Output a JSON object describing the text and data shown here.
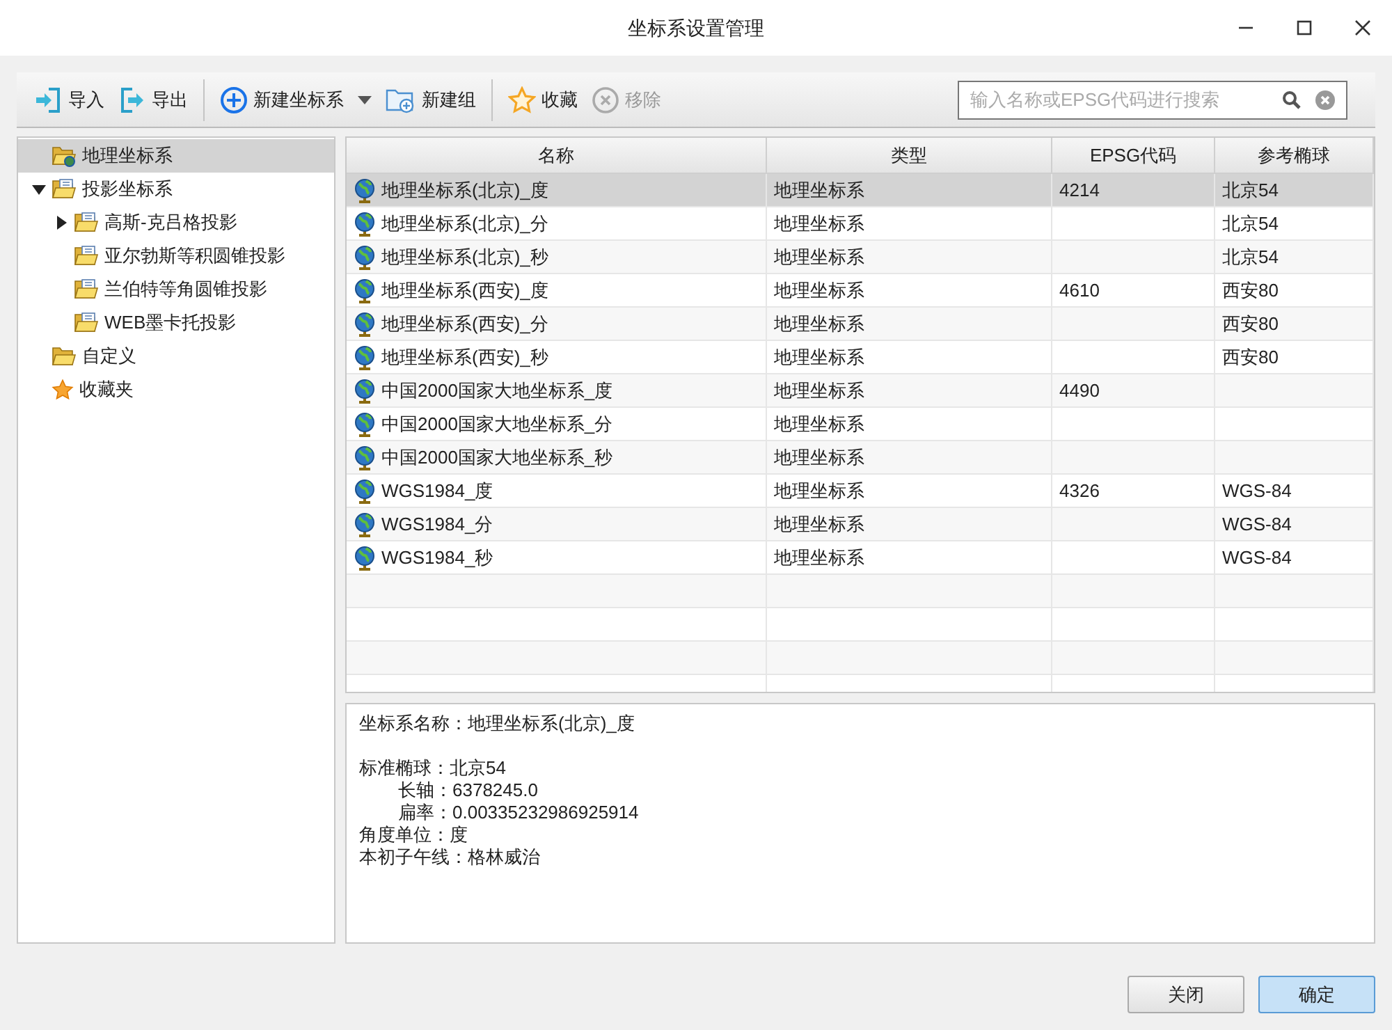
{
  "window": {
    "title": "坐标系设置管理"
  },
  "toolbar": {
    "groups": [
      [
        {
          "kind": "import",
          "label": "导入",
          "disabled": false
        },
        {
          "kind": "export",
          "label": "导出",
          "disabled": false
        }
      ],
      [
        {
          "kind": "add",
          "label": "新建坐标系",
          "disabled": false,
          "dropdown": true
        },
        {
          "kind": "new-group",
          "label": "新建组",
          "disabled": false
        }
      ],
      [
        {
          "kind": "favorite",
          "label": "收藏",
          "disabled": false
        },
        {
          "kind": "remove",
          "label": "移除",
          "disabled": true
        }
      ]
    ],
    "search": {
      "placeholder": "输入名称或EPSG代码进行搜索"
    }
  },
  "tree": [
    {
      "kind": "geo-folder",
      "label": "地理坐标系",
      "selected": true
    },
    {
      "kind": "proj-folder",
      "label": "投影坐标系",
      "selected": false,
      "expanded": true,
      "children": [
        {
          "kind": "proj-folder",
          "label": "高斯-克吕格投影",
          "selected": false,
          "expanded": false
        },
        {
          "kind": "proj-folder",
          "label": "亚尔勃斯等积圆锥投影",
          "selected": false
        },
        {
          "kind": "proj-folder",
          "label": "兰伯特等角圆锥投影",
          "selected": false
        },
        {
          "kind": "proj-folder",
          "label": "WEB墨卡托投影",
          "selected": false
        }
      ]
    },
    {
      "kind": "folder",
      "label": "自定义",
      "selected": false
    },
    {
      "kind": "favorites",
      "label": "收藏夹",
      "selected": false
    }
  ],
  "table": {
    "columns": [
      "名称",
      "类型",
      "EPSG代码",
      "参考椭球"
    ],
    "rows": [
      {
        "name": "地理坐标系(北京)_度",
        "type": "地理坐标系",
        "epsg": "4214",
        "ellipsoid": "北京54",
        "selected": true
      },
      {
        "name": "地理坐标系(北京)_分",
        "type": "地理坐标系",
        "ellipsoid": "北京54",
        "selected": false
      },
      {
        "name": "地理坐标系(北京)_秒",
        "type": "地理坐标系",
        "ellipsoid": "北京54",
        "selected": false
      },
      {
        "name": "地理坐标系(西安)_度",
        "type": "地理坐标系",
        "epsg": "4610",
        "ellipsoid": "西安80",
        "selected": false
      },
      {
        "name": "地理坐标系(西安)_分",
        "type": "地理坐标系",
        "ellipsoid": "西安80",
        "selected": false
      },
      {
        "name": "地理坐标系(西安)_秒",
        "type": "地理坐标系",
        "ellipsoid": "西安80",
        "selected": false
      },
      {
        "name": "中国2000国家大地坐标系_度",
        "type": "地理坐标系",
        "epsg": "4490",
        "selected": false
      },
      {
        "name": "中国2000国家大地坐标系_分",
        "type": "地理坐标系",
        "selected": false
      },
      {
        "name": "中国2000国家大地坐标系_秒",
        "type": "地理坐标系",
        "selected": false
      },
      {
        "name": "WGS1984_度",
        "type": "地理坐标系",
        "epsg": "4326",
        "ellipsoid": "WGS-84",
        "selected": false
      },
      {
        "name": "WGS1984_分",
        "type": "地理坐标系",
        "ellipsoid": "WGS-84",
        "selected": false
      },
      {
        "name": "WGS1984_秒",
        "type": "地理坐标系",
        "ellipsoid": "WGS-84",
        "selected": false
      }
    ]
  },
  "details": [
    {
      "label": "坐标系名称：",
      "value": "地理坐标系(北京)_度"
    },
    {
      "label": "标准椭球：",
      "value": "北京54",
      "children": [
        {
          "label": "长轴：",
          "value": "6378245.0"
        },
        {
          "label": "扁率：",
          "value": "0.00335232986925914"
        }
      ]
    },
    {
      "label": "角度单位：",
      "value": "度"
    },
    {
      "label": "本初子午线：",
      "value": "格林威治"
    }
  ],
  "buttons": [
    "关闭",
    "确定"
  ]
}
